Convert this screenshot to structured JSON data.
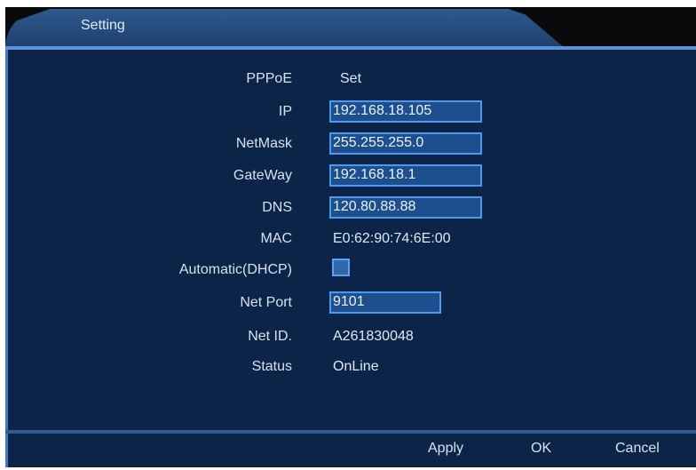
{
  "window": {
    "title": "Setting"
  },
  "fields": {
    "pppoe": {
      "label": "PPPoE",
      "value": "Set"
    },
    "ip": {
      "label": "IP",
      "value": "192.168.18.105"
    },
    "netmask": {
      "label": "NetMask",
      "value": "255.255.255.0"
    },
    "gateway": {
      "label": "GateWay",
      "value": "192.168.18.1"
    },
    "dns": {
      "label": "DNS",
      "value": "120.80.88.88"
    },
    "mac": {
      "label": "MAC",
      "value": "E0:62:90:74:6E:00"
    },
    "dhcp": {
      "label": "Automatic(DHCP)",
      "checked": false
    },
    "net_port": {
      "label": "Net Port",
      "value": "9101"
    },
    "net_id": {
      "label": "Net ID.",
      "value": "A261830048"
    },
    "status": {
      "label": "Status",
      "value": "OnLine"
    }
  },
  "footer": {
    "apply": "Apply",
    "ok": "OK",
    "cancel": "Cancel"
  }
}
